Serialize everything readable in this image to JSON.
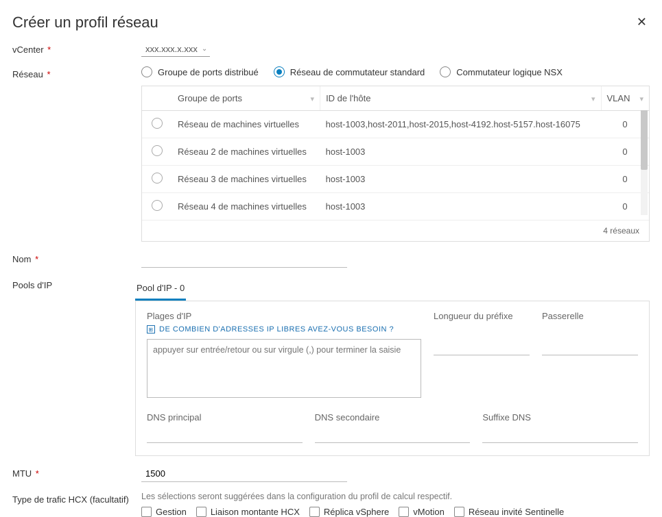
{
  "header": {
    "title": "Créer un profil réseau"
  },
  "vcenter": {
    "label": "vCenter",
    "value": "xxx.xxx.x.xxx"
  },
  "network": {
    "label": "Réseau",
    "options": {
      "distributed": "Groupe de ports distribué",
      "standard": "Réseau de commutateur standard",
      "nsx": "Commutateur logique NSX"
    },
    "selected": "standard",
    "columns": {
      "group": "Groupe de ports",
      "host": "ID de l'hôte",
      "vlan": "VLAN"
    },
    "rows": [
      {
        "group": "Réseau de machines virtuelles",
        "host": "host-1003,host-2011,host-2015,host-4192.host-5157.host-16075",
        "vlan": "0"
      },
      {
        "group": "Réseau 2 de machines virtuelles",
        "host": "host-1003",
        "vlan": "0"
      },
      {
        "group": "Réseau 3 de machines virtuelles",
        "host": "host-1003",
        "vlan": "0"
      },
      {
        "group": "Réseau 4 de machines virtuelles",
        "host": "host-1003",
        "vlan": "0"
      }
    ],
    "footer": "4 réseaux"
  },
  "name": {
    "label": "Nom"
  },
  "pools": {
    "label": "Pools d'IP",
    "tab": "Pool d'IP - 0",
    "ranges_label": "Plages d'IP",
    "prefix_label": "Longueur du préfixe",
    "gateway_label": "Passerelle",
    "calc_link": "DE COMBIEN D'ADRESSES IP LIBRES AVEZ-VOUS BESOIN ?",
    "textarea_placeholder": "appuyer sur entrée/retour ou sur virgule (,) pour terminer la saisie",
    "dns_primary": "DNS principal",
    "dns_secondary": "DNS secondaire",
    "dns_suffix": "Suffixe DNS"
  },
  "mtu": {
    "label": "MTU",
    "value": "1500"
  },
  "traffic": {
    "label": "Type de trafic HCX (facultatif)",
    "hint": "Les sélections seront suggérées dans la configuration du profil de calcul respectif.",
    "options": {
      "management": "Gestion",
      "uplink": "Liaison montante HCX",
      "replica": "Réplica vSphere",
      "vmotion": "vMotion",
      "sentinel": "Réseau invité Sentinelle"
    }
  }
}
